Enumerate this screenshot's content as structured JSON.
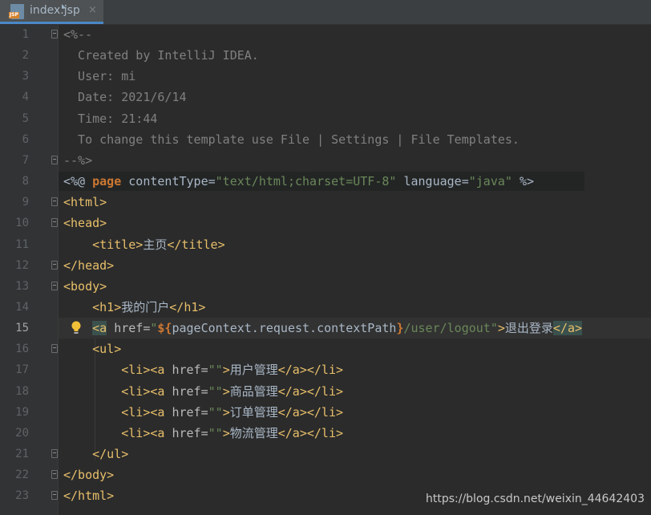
{
  "tab": {
    "filename": "index.jsp",
    "icon_badge": "JSP",
    "close": "×"
  },
  "lines": [
    {
      "n": "1",
      "fold": true,
      "parts": [
        [
          "cmt",
          "<%--"
        ]
      ]
    },
    {
      "n": "2",
      "fold": false,
      "parts": [
        [
          "cmt",
          "  Created by IntelliJ IDEA."
        ]
      ]
    },
    {
      "n": "3",
      "fold": false,
      "parts": [
        [
          "cmt",
          "  User: mi"
        ]
      ]
    },
    {
      "n": "4",
      "fold": false,
      "parts": [
        [
          "cmt",
          "  Date: 2021/6/14"
        ]
      ]
    },
    {
      "n": "5",
      "fold": false,
      "parts": [
        [
          "cmt",
          "  Time: 21:44"
        ]
      ]
    },
    {
      "n": "6",
      "fold": false,
      "parts": [
        [
          "cmt",
          "  To change this template use File | Settings | File Templates."
        ]
      ]
    },
    {
      "n": "7",
      "fold": true,
      "parts": [
        [
          "cmt",
          "--%>"
        ]
      ]
    },
    {
      "n": "8",
      "fold": false,
      "jsp": true,
      "parts": [
        [
          "plain",
          "<%@ "
        ],
        [
          "kw",
          "page"
        ],
        [
          "plain",
          " contentType="
        ],
        [
          "str",
          "\"text/html;charset=UTF-8\""
        ],
        [
          "plain",
          " language="
        ],
        [
          "str",
          "\"java\""
        ],
        [
          "plain",
          " %>"
        ]
      ]
    },
    {
      "n": "9",
      "fold": true,
      "parts": [
        [
          "tag",
          "<html>"
        ]
      ]
    },
    {
      "n": "10",
      "fold": true,
      "parts": [
        [
          "tag",
          "<head>"
        ]
      ]
    },
    {
      "n": "11",
      "fold": false,
      "parts": [
        [
          "plain",
          "    "
        ],
        [
          "tag",
          "<title>"
        ],
        [
          "plain",
          "主页"
        ],
        [
          "tag",
          "</title>"
        ]
      ]
    },
    {
      "n": "12",
      "fold": true,
      "parts": [
        [
          "tag",
          "</head>"
        ]
      ]
    },
    {
      "n": "13",
      "fold": true,
      "parts": [
        [
          "tag",
          "<body>"
        ]
      ]
    },
    {
      "n": "14",
      "fold": false,
      "parts": [
        [
          "plain",
          "    "
        ],
        [
          "tag",
          "<h1>"
        ],
        [
          "plain",
          "我的门户"
        ],
        [
          "tag",
          "</h1>"
        ]
      ]
    },
    {
      "n": "15",
      "fold": false,
      "current": true,
      "parts": [
        [
          "plain",
          "    "
        ],
        [
          "tag hlpair",
          "<a"
        ],
        [
          "attr",
          " href="
        ],
        [
          "str",
          "\""
        ],
        [
          "kw",
          "${"
        ],
        [
          "plain",
          "pageContext.request.contextPath"
        ],
        [
          "kw",
          "}"
        ],
        [
          "str",
          "/user/logout\""
        ],
        [
          "tag",
          ">"
        ],
        [
          "plain",
          "退出登录"
        ],
        [
          "tag hlpair",
          "</a>"
        ]
      ]
    },
    {
      "n": "16",
      "fold": true,
      "parts": [
        [
          "plain",
          "    "
        ],
        [
          "tag",
          "<ul>"
        ]
      ]
    },
    {
      "n": "17",
      "fold": false,
      "parts": [
        [
          "plain",
          "        "
        ],
        [
          "tag",
          "<li><a"
        ],
        [
          "attr",
          " href="
        ],
        [
          "str",
          "\"\""
        ],
        [
          "tag",
          ">"
        ],
        [
          "plain",
          "用户管理"
        ],
        [
          "tag",
          "</a></li>"
        ]
      ]
    },
    {
      "n": "18",
      "fold": false,
      "parts": [
        [
          "plain",
          "        "
        ],
        [
          "tag",
          "<li><a"
        ],
        [
          "attr",
          " href="
        ],
        [
          "str",
          "\"\""
        ],
        [
          "tag",
          ">"
        ],
        [
          "plain",
          "商品管理"
        ],
        [
          "tag",
          "</a></li>"
        ]
      ]
    },
    {
      "n": "19",
      "fold": false,
      "parts": [
        [
          "plain",
          "        "
        ],
        [
          "tag",
          "<li><a"
        ],
        [
          "attr",
          " href="
        ],
        [
          "str",
          "\"\""
        ],
        [
          "tag",
          ">"
        ],
        [
          "plain",
          "订单管理"
        ],
        [
          "tag",
          "</a></li>"
        ]
      ]
    },
    {
      "n": "20",
      "fold": false,
      "parts": [
        [
          "plain",
          "        "
        ],
        [
          "tag",
          "<li><a"
        ],
        [
          "attr",
          " href="
        ],
        [
          "str",
          "\"\""
        ],
        [
          "tag",
          ">"
        ],
        [
          "plain",
          "物流管理"
        ],
        [
          "tag",
          "</a></li>"
        ]
      ]
    },
    {
      "n": "21",
      "fold": true,
      "parts": [
        [
          "plain",
          "    "
        ],
        [
          "tag",
          "</ul>"
        ]
      ]
    },
    {
      "n": "22",
      "fold": true,
      "parts": [
        [
          "tag",
          "</body>"
        ]
      ]
    },
    {
      "n": "23",
      "fold": true,
      "parts": [
        [
          "tag",
          "</html>"
        ]
      ]
    }
  ],
  "watermark": "https://blog.csdn.net/weixin_44642403",
  "colors": {
    "background": "#2b2b2b",
    "tag": "#e8bf6a",
    "string": "#6a8759",
    "keyword": "#cc7832",
    "comment": "#808080"
  }
}
